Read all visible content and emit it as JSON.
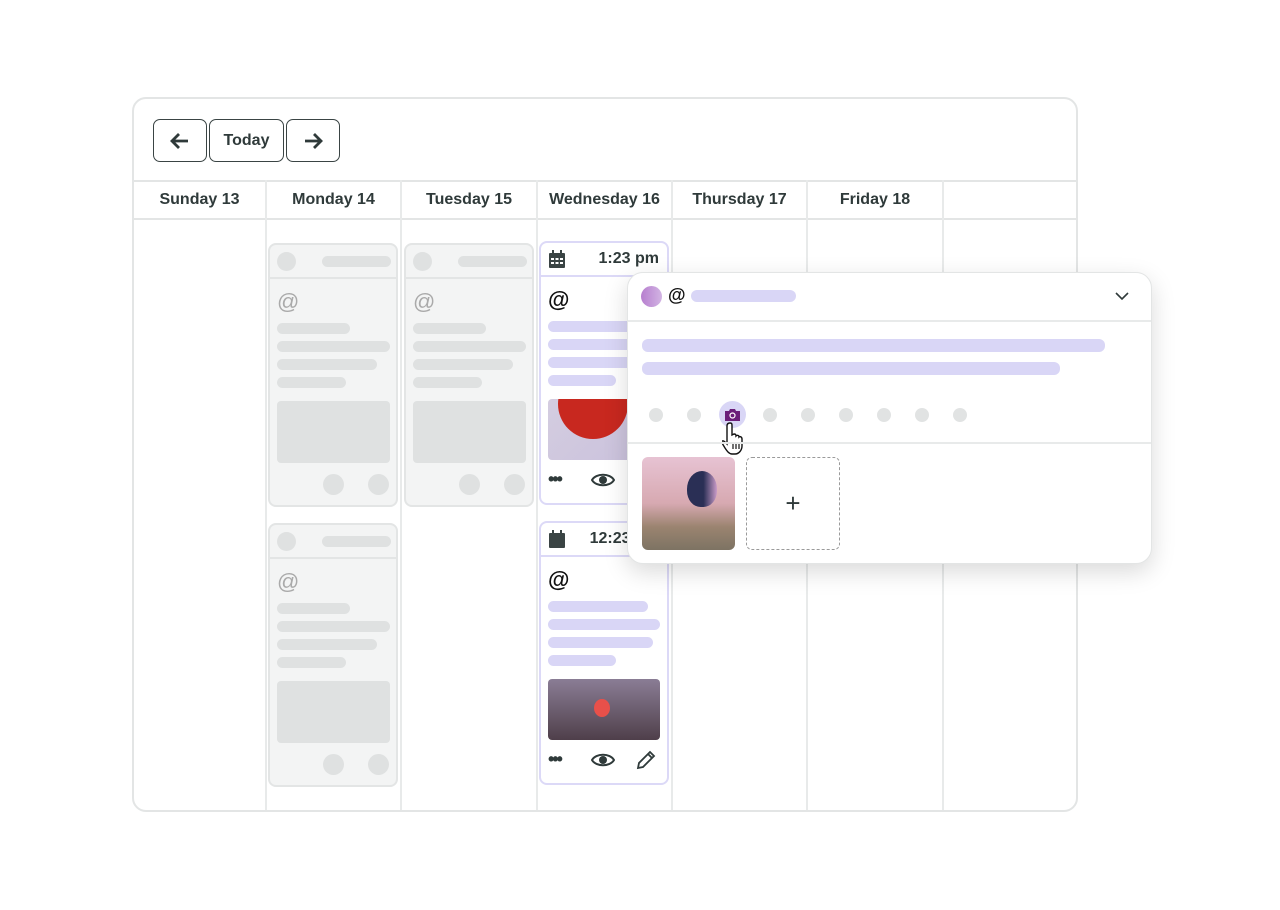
{
  "toolbar": {
    "prev_icon": "arrow-left-icon",
    "today_label": "Today",
    "next_icon": "arrow-right-icon"
  },
  "days": [
    "Sunday 13",
    "Monday 14",
    "Tuesday 15",
    "Wednesday 16",
    "Thursday 17",
    "Friday 18"
  ],
  "posts": [
    {
      "time": "1:23 pm"
    },
    {
      "time": "12:23 pm"
    }
  ],
  "popup": {
    "network_icon": "threads-icon",
    "selected_tool": "camera-icon",
    "add_label": "+"
  },
  "colors": {
    "accent": "#d9d6f6",
    "camera": "#6b1f7a",
    "placeholder": "#dfe1e1"
  }
}
